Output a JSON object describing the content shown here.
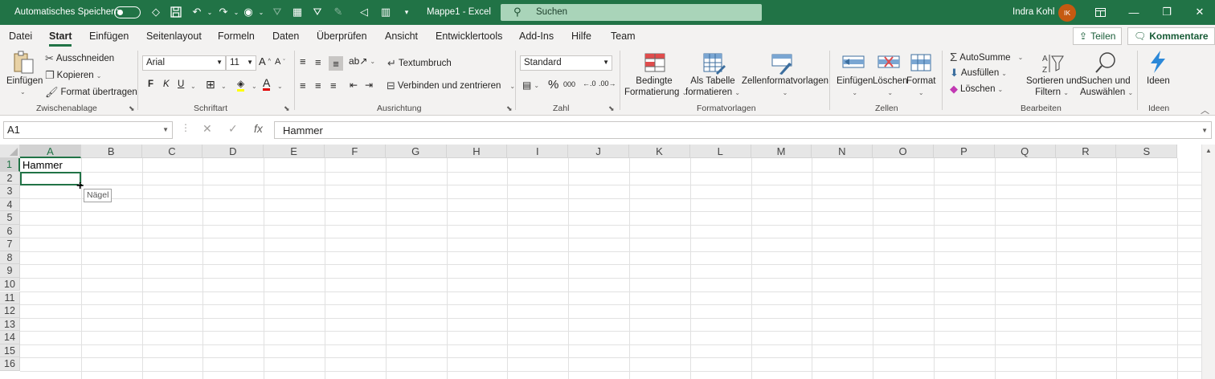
{
  "titlebar": {
    "autosave_label": "Automatisches Speichern",
    "doc_title": "Mappe1  -  Excel",
    "search_placeholder": "Suchen",
    "user_name": "Indra Kohl",
    "user_initials": "IK"
  },
  "tabs": [
    "Datei",
    "Start",
    "Einfügen",
    "Seitenlayout",
    "Formeln",
    "Daten",
    "Überprüfen",
    "Ansicht",
    "Entwicklertools",
    "Add-Ins",
    "Hilfe",
    "Team"
  ],
  "share": {
    "share_label": "Teilen",
    "comments_label": "Kommentare"
  },
  "ribbon": {
    "clipboard": {
      "paste": "Einfügen",
      "cut": "Ausschneiden",
      "copy": "Kopieren",
      "format_painter": "Format übertragen",
      "label": "Zwischenablage"
    },
    "font": {
      "name": "Arial",
      "size": "11",
      "bold": "F",
      "italic": "K",
      "underline": "U",
      "label": "Schriftart"
    },
    "alignment": {
      "wrap": "Textumbruch",
      "merge": "Verbinden und zentrieren",
      "label": "Ausrichtung"
    },
    "number": {
      "format": "Standard",
      "label": "Zahl"
    },
    "styles": {
      "conditional_l1": "Bedingte",
      "conditional_l2": "Formatierung",
      "table_l1": "Als Tabelle",
      "table_l2": "formatieren",
      "cell_styles": "Zellenformatvorlagen",
      "label": "Formatvorlagen"
    },
    "cells": {
      "insert": "Einfügen",
      "delete": "Löschen",
      "format": "Format",
      "label": "Zellen"
    },
    "editing": {
      "autosum": "AutoSumme",
      "fill": "Ausfüllen",
      "clear": "Löschen",
      "sort_l1": "Sortieren und",
      "sort_l2": "Filtern",
      "find_l1": "Suchen und",
      "find_l2": "Auswählen",
      "label": "Bearbeiten"
    },
    "ideas": {
      "ideas": "Ideen",
      "label": "Ideen"
    }
  },
  "formula_bar": {
    "name_box": "A1",
    "content": "Hammer"
  },
  "sheet": {
    "columns": [
      "A",
      "B",
      "C",
      "D",
      "E",
      "F",
      "G",
      "H",
      "I",
      "J",
      "K",
      "L",
      "M",
      "N",
      "O",
      "P",
      "Q",
      "R",
      "S"
    ],
    "rows": [
      "1",
      "2",
      "3",
      "4",
      "5",
      "6",
      "7",
      "8",
      "9",
      "10",
      "11",
      "12",
      "13",
      "14",
      "15",
      "16"
    ],
    "cell_a1": "Hammer",
    "autofill_tooltip": "Nägel"
  },
  "colors": {
    "accent": "#217346"
  }
}
